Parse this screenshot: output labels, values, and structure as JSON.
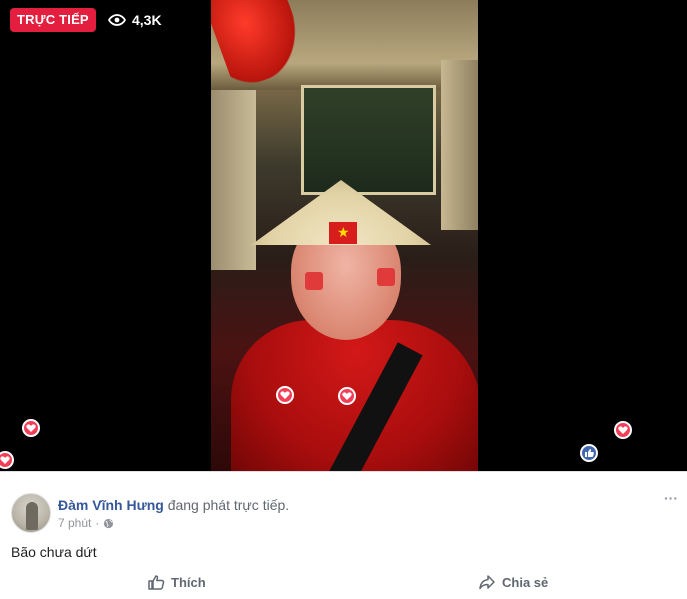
{
  "live": {
    "badge": "TRỰC TIẾP",
    "viewer_count": "4,3K"
  },
  "post": {
    "author": "Đàm Vĩnh Hưng",
    "action": "đang phát trực tiếp.",
    "time": "7 phút",
    "caption": "Bão chưa dứt",
    "more_icon": "more-dots-icon",
    "privacy_icon": "globe-icon"
  },
  "actions": {
    "like": "Thích",
    "share": "Chia sẻ"
  },
  "colors": {
    "live_red": "#e41e3f",
    "link_blue": "#365899",
    "heart": "#f33e58",
    "like_blue": "#4267b2"
  }
}
